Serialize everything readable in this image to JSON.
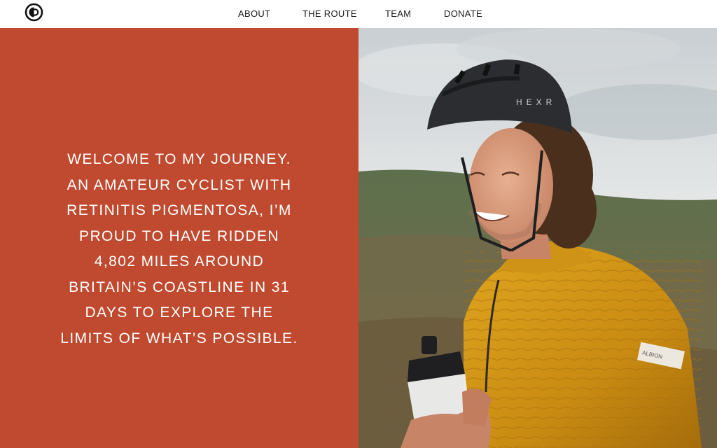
{
  "nav": {
    "logo_icon": "circular-logo-icon",
    "items": [
      {
        "label": "ABOUT"
      },
      {
        "label": "THE ROUTE"
      },
      {
        "label": "TEAM"
      },
      {
        "label": "DONATE"
      }
    ]
  },
  "hero": {
    "background_color": "#c04a30",
    "lines": [
      "WELCOME TO MY JOURNEY.",
      "AN AMATEUR CYCLIST WITH",
      "RETINITIS PIGMENTOSA, I’M",
      "PROUD TO HAVE RIDDEN",
      "4,802 MILES AROUND",
      "BRITAIN’S COASTLINE IN 31",
      "DAYS TO EXPLORE THE",
      "LIMITS OF WHAT’S POSSIBLE."
    ],
    "photo": {
      "helmet_brand": "HEXR",
      "sleeve_label": "ALBION"
    }
  }
}
